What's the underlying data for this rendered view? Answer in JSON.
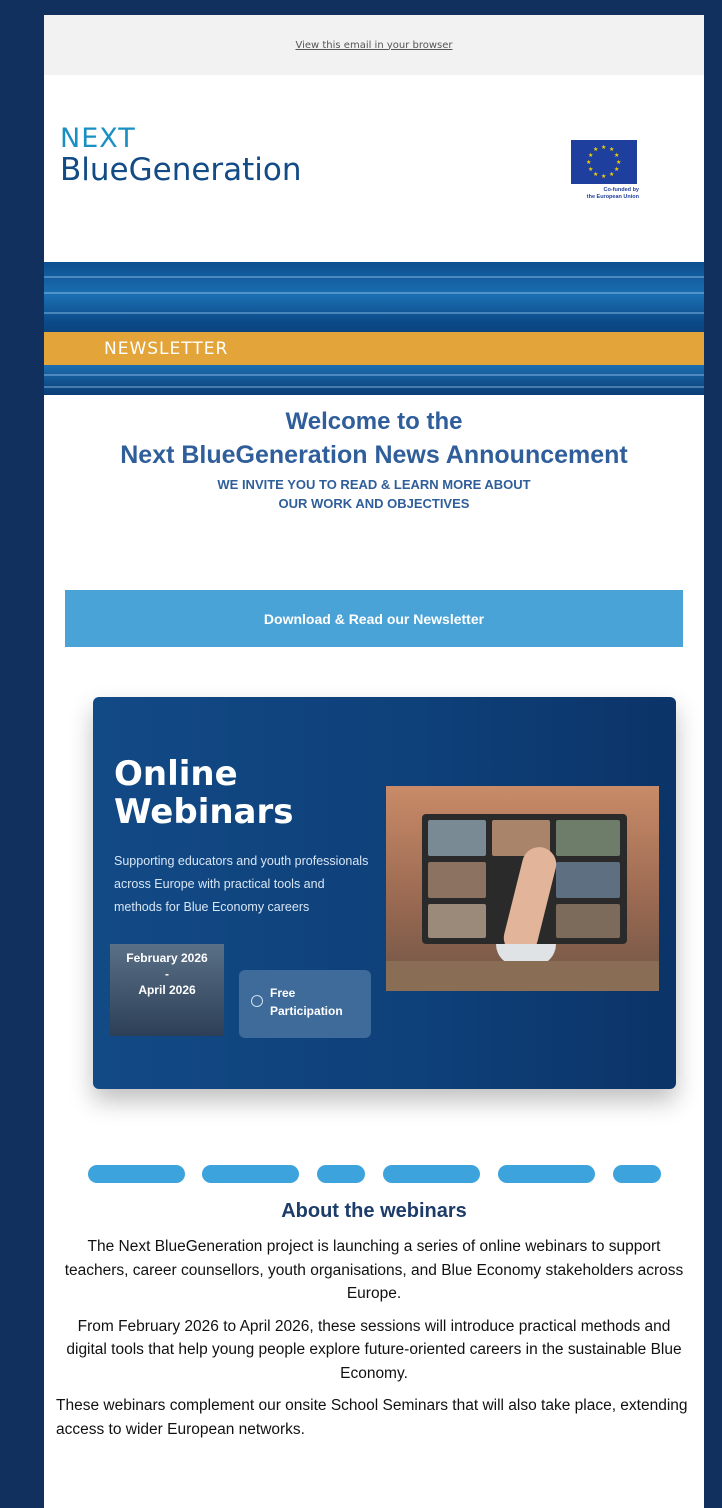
{
  "topbar": {
    "view_link": "View this email in your browser"
  },
  "header": {
    "logo_line1": "NEXT",
    "logo_line2": "BlueGeneration",
    "eu_label_1": "Co-funded by",
    "eu_label_2": "the European Union"
  },
  "banner": {
    "label": "NEWSLETTER"
  },
  "welcome": {
    "title_1": "Welcome to the",
    "title_2": "Next BlueGeneration News Announcement",
    "subtitle_1": "WE INVITE YOU TO READ & LEARN MORE ABOUT",
    "subtitle_2": "OUR WORK AND OBJECTIVES"
  },
  "cta": {
    "download_label": "Download & Read our Newsletter"
  },
  "webinar_card": {
    "title_1": "Online",
    "title_2": "Webinars",
    "description": "Supporting educators and youth professionals across Europe with practical tools and methods for Blue Economy careers",
    "date_start": "February 2026",
    "date_sep": "-",
    "date_end": "April 2026",
    "free_1": "Free",
    "free_2": "Participation"
  },
  "about": {
    "heading": "About the webinars",
    "p1": "The Next BlueGeneration project is launching a series of online webinars to support teachers, career counsellors, youth organisations, and Blue Economy stakeholders across Europe.",
    "p2": "From February 2026 to April 2026, these sessions will introduce practical methods and digital tools that help young people explore future-oriented careers in the sustainable Blue Economy.",
    "p3": "These webinars complement our onsite School Seminars that will also take place, extending access to wider European networks."
  },
  "colors": {
    "page_bg": "#12305e",
    "accent_blue": "#4aa3d7",
    "heading_blue": "#2f5e9a",
    "banner_gold": "#e3a43a"
  }
}
